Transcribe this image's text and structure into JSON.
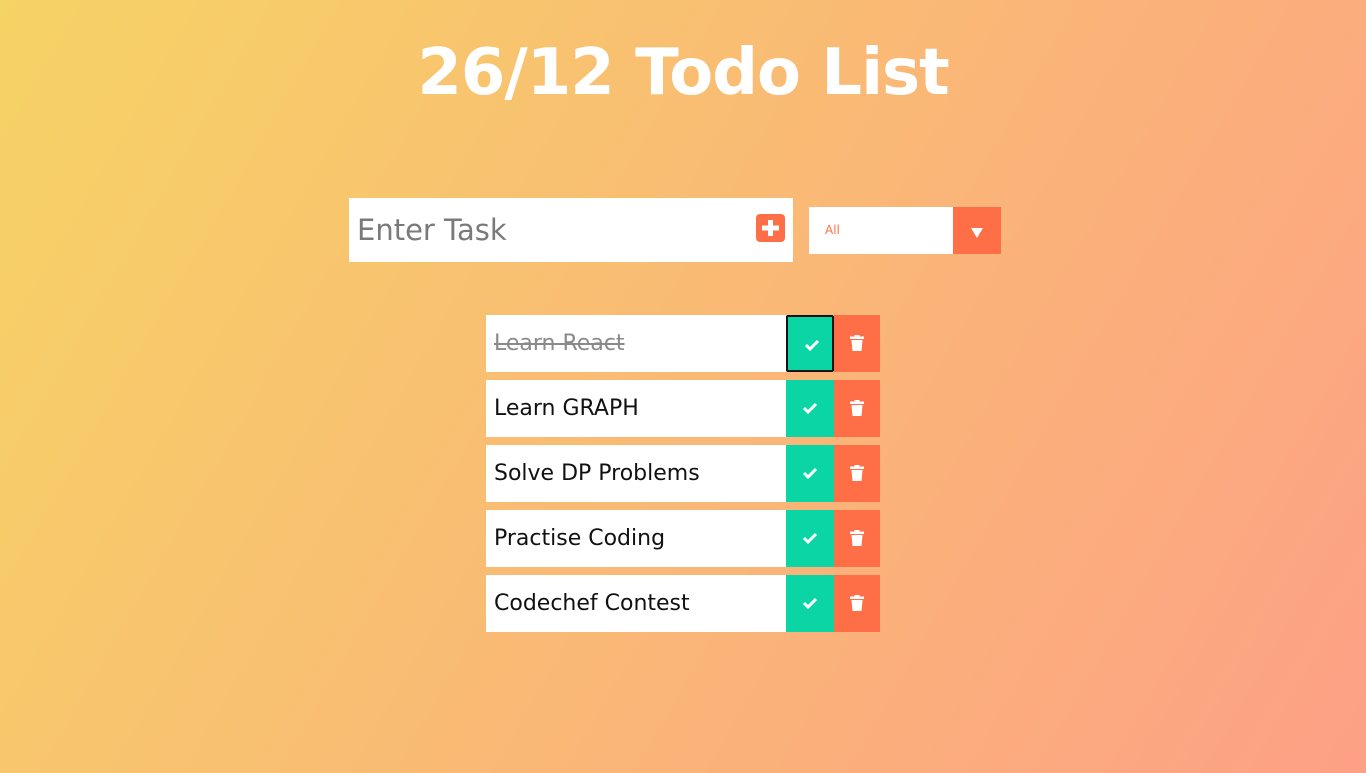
{
  "app": {
    "title": "26/12 Todo List"
  },
  "form": {
    "placeholder": "Enter Task",
    "value": "",
    "add_icon": "plus-square-icon"
  },
  "filter": {
    "selected": "All",
    "arrow_icon": "triangle-down-icon"
  },
  "todos": [
    {
      "text": "Learn React",
      "completed": true
    },
    {
      "text": "Learn GRAPH",
      "completed": false
    },
    {
      "text": "Solve DP Problems",
      "completed": false
    },
    {
      "text": "Practise Coding",
      "completed": false
    },
    {
      "text": "Codechef Contest",
      "completed": false
    }
  ],
  "icons": {
    "complete": "check-icon",
    "delete": "trash-icon"
  },
  "colors": {
    "gradient_start": "#f6d365",
    "gradient_end": "#fda085",
    "accent": "#ff6f47",
    "complete": "#0bd4a5",
    "title": "#ffffff"
  }
}
